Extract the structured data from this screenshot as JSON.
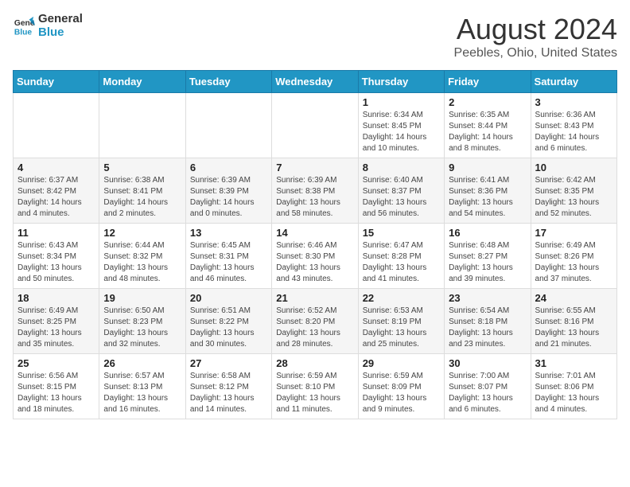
{
  "logo": {
    "line1": "General",
    "line2": "Blue"
  },
  "title": "August 2024",
  "subtitle": "Peebles, Ohio, United States",
  "days_of_week": [
    "Sunday",
    "Monday",
    "Tuesday",
    "Wednesday",
    "Thursday",
    "Friday",
    "Saturday"
  ],
  "weeks": [
    [
      {
        "day": "",
        "info": ""
      },
      {
        "day": "",
        "info": ""
      },
      {
        "day": "",
        "info": ""
      },
      {
        "day": "",
        "info": ""
      },
      {
        "day": "1",
        "info": "Sunrise: 6:34 AM\nSunset: 8:45 PM\nDaylight: 14 hours\nand 10 minutes."
      },
      {
        "day": "2",
        "info": "Sunrise: 6:35 AM\nSunset: 8:44 PM\nDaylight: 14 hours\nand 8 minutes."
      },
      {
        "day": "3",
        "info": "Sunrise: 6:36 AM\nSunset: 8:43 PM\nDaylight: 14 hours\nand 6 minutes."
      }
    ],
    [
      {
        "day": "4",
        "info": "Sunrise: 6:37 AM\nSunset: 8:42 PM\nDaylight: 14 hours\nand 4 minutes."
      },
      {
        "day": "5",
        "info": "Sunrise: 6:38 AM\nSunset: 8:41 PM\nDaylight: 14 hours\nand 2 minutes."
      },
      {
        "day": "6",
        "info": "Sunrise: 6:39 AM\nSunset: 8:39 PM\nDaylight: 14 hours\nand 0 minutes."
      },
      {
        "day": "7",
        "info": "Sunrise: 6:39 AM\nSunset: 8:38 PM\nDaylight: 13 hours\nand 58 minutes."
      },
      {
        "day": "8",
        "info": "Sunrise: 6:40 AM\nSunset: 8:37 PM\nDaylight: 13 hours\nand 56 minutes."
      },
      {
        "day": "9",
        "info": "Sunrise: 6:41 AM\nSunset: 8:36 PM\nDaylight: 13 hours\nand 54 minutes."
      },
      {
        "day": "10",
        "info": "Sunrise: 6:42 AM\nSunset: 8:35 PM\nDaylight: 13 hours\nand 52 minutes."
      }
    ],
    [
      {
        "day": "11",
        "info": "Sunrise: 6:43 AM\nSunset: 8:34 PM\nDaylight: 13 hours\nand 50 minutes."
      },
      {
        "day": "12",
        "info": "Sunrise: 6:44 AM\nSunset: 8:32 PM\nDaylight: 13 hours\nand 48 minutes."
      },
      {
        "day": "13",
        "info": "Sunrise: 6:45 AM\nSunset: 8:31 PM\nDaylight: 13 hours\nand 46 minutes."
      },
      {
        "day": "14",
        "info": "Sunrise: 6:46 AM\nSunset: 8:30 PM\nDaylight: 13 hours\nand 43 minutes."
      },
      {
        "day": "15",
        "info": "Sunrise: 6:47 AM\nSunset: 8:28 PM\nDaylight: 13 hours\nand 41 minutes."
      },
      {
        "day": "16",
        "info": "Sunrise: 6:48 AM\nSunset: 8:27 PM\nDaylight: 13 hours\nand 39 minutes."
      },
      {
        "day": "17",
        "info": "Sunrise: 6:49 AM\nSunset: 8:26 PM\nDaylight: 13 hours\nand 37 minutes."
      }
    ],
    [
      {
        "day": "18",
        "info": "Sunrise: 6:49 AM\nSunset: 8:25 PM\nDaylight: 13 hours\nand 35 minutes."
      },
      {
        "day": "19",
        "info": "Sunrise: 6:50 AM\nSunset: 8:23 PM\nDaylight: 13 hours\nand 32 minutes."
      },
      {
        "day": "20",
        "info": "Sunrise: 6:51 AM\nSunset: 8:22 PM\nDaylight: 13 hours\nand 30 minutes."
      },
      {
        "day": "21",
        "info": "Sunrise: 6:52 AM\nSunset: 8:20 PM\nDaylight: 13 hours\nand 28 minutes."
      },
      {
        "day": "22",
        "info": "Sunrise: 6:53 AM\nSunset: 8:19 PM\nDaylight: 13 hours\nand 25 minutes."
      },
      {
        "day": "23",
        "info": "Sunrise: 6:54 AM\nSunset: 8:18 PM\nDaylight: 13 hours\nand 23 minutes."
      },
      {
        "day": "24",
        "info": "Sunrise: 6:55 AM\nSunset: 8:16 PM\nDaylight: 13 hours\nand 21 minutes."
      }
    ],
    [
      {
        "day": "25",
        "info": "Sunrise: 6:56 AM\nSunset: 8:15 PM\nDaylight: 13 hours\nand 18 minutes."
      },
      {
        "day": "26",
        "info": "Sunrise: 6:57 AM\nSunset: 8:13 PM\nDaylight: 13 hours\nand 16 minutes."
      },
      {
        "day": "27",
        "info": "Sunrise: 6:58 AM\nSunset: 8:12 PM\nDaylight: 13 hours\nand 14 minutes."
      },
      {
        "day": "28",
        "info": "Sunrise: 6:59 AM\nSunset: 8:10 PM\nDaylight: 13 hours\nand 11 minutes."
      },
      {
        "day": "29",
        "info": "Sunrise: 6:59 AM\nSunset: 8:09 PM\nDaylight: 13 hours\nand 9 minutes."
      },
      {
        "day": "30",
        "info": "Sunrise: 7:00 AM\nSunset: 8:07 PM\nDaylight: 13 hours\nand 6 minutes."
      },
      {
        "day": "31",
        "info": "Sunrise: 7:01 AM\nSunset: 8:06 PM\nDaylight: 13 hours\nand 4 minutes."
      }
    ]
  ]
}
